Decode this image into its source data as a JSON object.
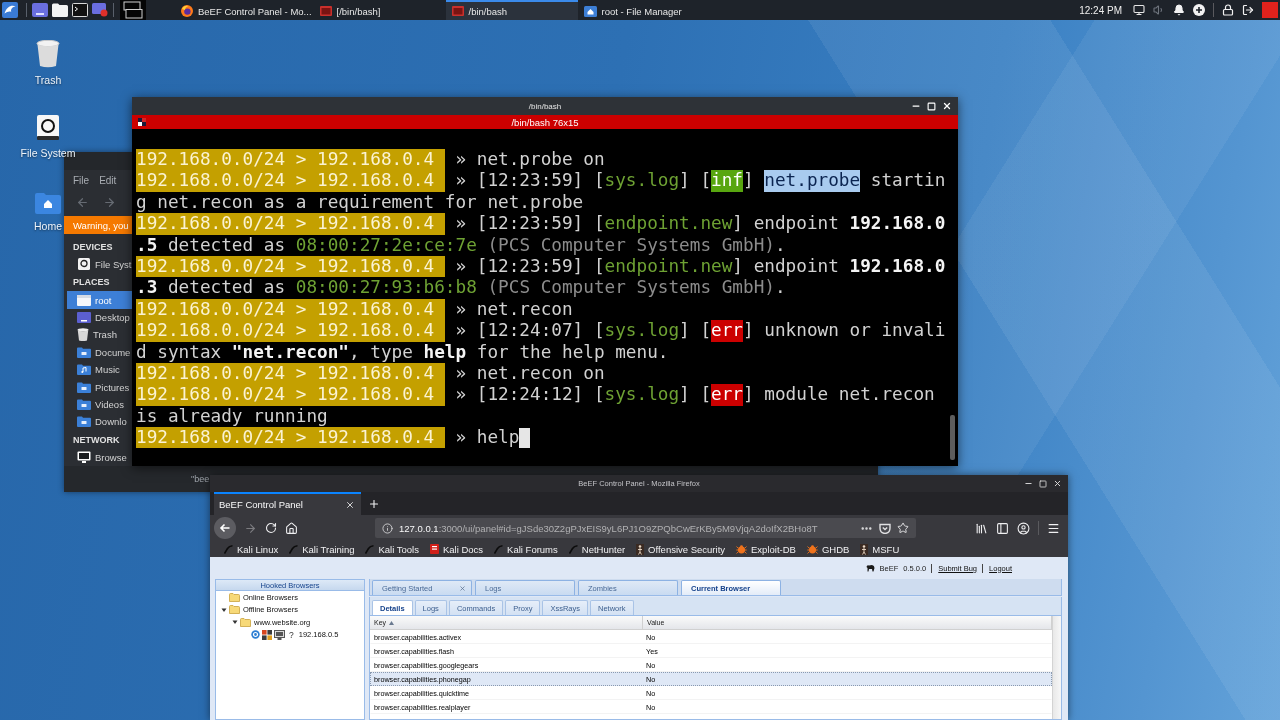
{
  "taskbar": {
    "tasks": [
      {
        "label": "BeEF Control Panel - Mo...",
        "kind": "browser",
        "selected": false
      },
      {
        "label": "[/bin/bash]",
        "kind": "terminal",
        "selected": false
      },
      {
        "label": "/bin/bash",
        "kind": "terminal",
        "selected": true
      },
      {
        "label": "root - File Manager",
        "kind": "files",
        "selected": false
      }
    ],
    "clock": "12:24 PM"
  },
  "desktop_icons": [
    {
      "label": "Trash",
      "kind": "trash"
    },
    {
      "label": "File System",
      "kind": "drive"
    },
    {
      "label": "Home",
      "kind": "home"
    }
  ],
  "file_manager": {
    "menu": [
      "File",
      "Edit"
    ],
    "warning": "Warning, you",
    "sections": [
      {
        "title": "DEVICES",
        "items": [
          {
            "label": "File Syst",
            "kind": "drive",
            "selected": false
          }
        ]
      },
      {
        "title": "PLACES",
        "items": [
          {
            "label": "root",
            "kind": "home",
            "selected": true
          },
          {
            "label": "Desktop",
            "kind": "desktop",
            "selected": false
          },
          {
            "label": "Trash",
            "kind": "trash",
            "selected": false
          },
          {
            "label": "Docume",
            "kind": "folder",
            "selected": false
          },
          {
            "label": "Music",
            "kind": "music",
            "selected": false
          },
          {
            "label": "Pictures",
            "kind": "folder",
            "selected": false
          },
          {
            "label": "Videos",
            "kind": "folder",
            "selected": false
          },
          {
            "label": "Downlo",
            "kind": "folder",
            "selected": false
          }
        ]
      },
      {
        "title": "NETWORK",
        "items": [
          {
            "label": "Browse",
            "kind": "network",
            "selected": false
          }
        ]
      }
    ],
    "status": "\"bee"
  },
  "terminal": {
    "title": "/bin/bash",
    "tab": "/bin/bash 76x15",
    "cursor_visible": true,
    "lines": [
      [
        {
          "kind": "prompt",
          "text": "192.168.0.0/24 > 192.168.0.4"
        },
        {
          "kind": "plain",
          "text": "» net.probe on"
        }
      ],
      [
        {
          "kind": "prompt",
          "text": "192.168.0.0/24 > 192.168.0.4"
        },
        {
          "kind": "plain",
          "text": "» [12:23:59] ["
        },
        {
          "kind": "tag",
          "text": "sys.log"
        },
        {
          "kind": "plain",
          "text": "] ["
        },
        {
          "kind": "info",
          "text": "inf"
        },
        {
          "kind": "plain",
          "text": "] "
        },
        {
          "kind": "selected",
          "text": "net.probe"
        },
        {
          "kind": "plain",
          "text": " startin"
        }
      ],
      [
        {
          "kind": "plain",
          "text": "g net.recon as a requirement for net.probe"
        }
      ],
      [
        {
          "kind": "prompt",
          "text": "192.168.0.0/24 > 192.168.0.4"
        },
        {
          "kind": "plain",
          "text": "» [12:23:59] ["
        },
        {
          "kind": "tag",
          "text": "endpoint.new"
        },
        {
          "kind": "plain",
          "text": "] endpoint "
        },
        {
          "kind": "bold",
          "text": "192.168.0"
        }
      ],
      [
        {
          "kind": "bold",
          "text": ".5"
        },
        {
          "kind": "plain",
          "text": " detected as "
        },
        {
          "kind": "mac",
          "text": "08:00:27:2e:ce:7e"
        },
        {
          "kind": "dim",
          "text": " (PCS Computer Systems GmbH)"
        },
        {
          "kind": "plain",
          "text": "."
        }
      ],
      [
        {
          "kind": "prompt",
          "text": "192.168.0.0/24 > 192.168.0.4"
        },
        {
          "kind": "plain",
          "text": "» [12:23:59] ["
        },
        {
          "kind": "tag",
          "text": "endpoint.new"
        },
        {
          "kind": "plain",
          "text": "] endpoint "
        },
        {
          "kind": "bold",
          "text": "192.168.0"
        }
      ],
      [
        {
          "kind": "bold",
          "text": ".3"
        },
        {
          "kind": "plain",
          "text": " detected as "
        },
        {
          "kind": "mac",
          "text": "08:00:27:93:b6:b8"
        },
        {
          "kind": "dim",
          "text": " (PCS Computer Systems GmbH)"
        },
        {
          "kind": "plain",
          "text": "."
        }
      ],
      [
        {
          "kind": "prompt",
          "text": "192.168.0.0/24 > 192.168.0.4"
        },
        {
          "kind": "plain",
          "text": "» net.recon"
        }
      ],
      [
        {
          "kind": "prompt",
          "text": "192.168.0.0/24 > 192.168.0.4"
        },
        {
          "kind": "plain",
          "text": "» [12:24:07] ["
        },
        {
          "kind": "tag",
          "text": "sys.log"
        },
        {
          "kind": "plain",
          "text": "] ["
        },
        {
          "kind": "error",
          "text": "err"
        },
        {
          "kind": "plain",
          "text": "] unknown or invali"
        }
      ],
      [
        {
          "kind": "plain",
          "text": "d syntax "
        },
        {
          "kind": "bold",
          "text": "\"net.recon\""
        },
        {
          "kind": "plain",
          "text": ", type "
        },
        {
          "kind": "bold",
          "text": "help"
        },
        {
          "kind": "plain",
          "text": " for the help menu."
        }
      ],
      [
        {
          "kind": "prompt",
          "text": "192.168.0.0/24 > 192.168.0.4"
        },
        {
          "kind": "plain",
          "text": "» net.recon on"
        }
      ],
      [
        {
          "kind": "prompt",
          "text": "192.168.0.0/24 > 192.168.0.4"
        },
        {
          "kind": "plain",
          "text": "» [12:24:12] ["
        },
        {
          "kind": "tag",
          "text": "sys.log"
        },
        {
          "kind": "plain",
          "text": "] ["
        },
        {
          "kind": "error",
          "text": "err"
        },
        {
          "kind": "plain",
          "text": "] module net.recon"
        }
      ],
      [
        {
          "kind": "plain",
          "text": "is already running"
        }
      ],
      [
        {
          "kind": "prompt",
          "text": "192.168.0.0/24 > 192.168.0.4"
        },
        {
          "kind": "plain",
          "text": "» help"
        }
      ]
    ]
  },
  "browser": {
    "title": "BeEF Control Panel - Mozilla Firefox",
    "tabs": [
      {
        "label": "BeEF Control Panel",
        "selected": true
      }
    ],
    "url": {
      "host": "127.0.0.1",
      "path": ":3000/ui/panel#id=gJSde30Z2gPJxEIS9yL6PJ1O9ZPQbCwErKBy5M9VjqA2doIfX2BHo8T"
    },
    "bookmarks": [
      {
        "label": "Kali Linux",
        "kind": "dragon"
      },
      {
        "label": "Kali Training",
        "kind": "dragon"
      },
      {
        "label": "Kali Tools",
        "kind": "dragon"
      },
      {
        "label": "Kali Docs",
        "kind": "docs"
      },
      {
        "label": "Kali Forums",
        "kind": "dragon"
      },
      {
        "label": "NetHunter",
        "kind": "dragon"
      },
      {
        "label": "Offensive Security",
        "kind": "figure"
      },
      {
        "label": "Exploit-DB",
        "kind": "bug"
      },
      {
        "label": "GHDB",
        "kind": "bug"
      },
      {
        "label": "MSFU",
        "kind": "figure"
      }
    ],
    "page": {
      "header": {
        "brand": "BeEF",
        "version": "0.5.0.0",
        "links": [
          "Submit Bug",
          "Logout"
        ]
      },
      "hooked_browsers": {
        "title": "Hooked Browsers",
        "tree": [
          {
            "label": "Online Browsers",
            "kind": "folder"
          },
          {
            "label": "Offline Browsers",
            "kind": "folder",
            "expanded": true,
            "children": [
              {
                "label": "www.website.org",
                "kind": "folder",
                "expanded": true,
                "children": [
                  {
                    "label": "192.168.0.5",
                    "kind": "host",
                    "hardware": "?"
                  }
                ]
              }
            ]
          }
        ]
      },
      "tabs": [
        {
          "label": "Getting Started",
          "selected": false,
          "closable": true
        },
        {
          "label": "Logs",
          "selected": false,
          "closable": false
        },
        {
          "label": "Zombies",
          "selected": false,
          "closable": false
        },
        {
          "label": "Current Browser",
          "selected": true,
          "closable": false
        }
      ],
      "sub_tabs": [
        {
          "label": "Details",
          "selected": true
        },
        {
          "label": "Logs",
          "selected": false
        },
        {
          "label": "Commands",
          "selected": false
        },
        {
          "label": "Proxy",
          "selected": false
        },
        {
          "label": "XssRays",
          "selected": false
        },
        {
          "label": "Network",
          "selected": false
        }
      ],
      "table": {
        "columns": [
          {
            "label": "Key",
            "sorted": true
          },
          {
            "label": "Value",
            "sorted": false
          }
        ],
        "rows": [
          {
            "key": "browser.capabilities.activex",
            "value": "No",
            "selected": false
          },
          {
            "key": "browser.capabilities.flash",
            "value": "Yes",
            "selected": false
          },
          {
            "key": "browser.capabilities.googlegears",
            "value": "No",
            "selected": false
          },
          {
            "key": "browser.capabilities.phonegap",
            "value": "No",
            "selected": true
          },
          {
            "key": "browser.capabilities.quicktime",
            "value": "No",
            "selected": false
          },
          {
            "key": "browser.capabilities.realplayer",
            "value": "No",
            "selected": false
          }
        ]
      }
    }
  }
}
